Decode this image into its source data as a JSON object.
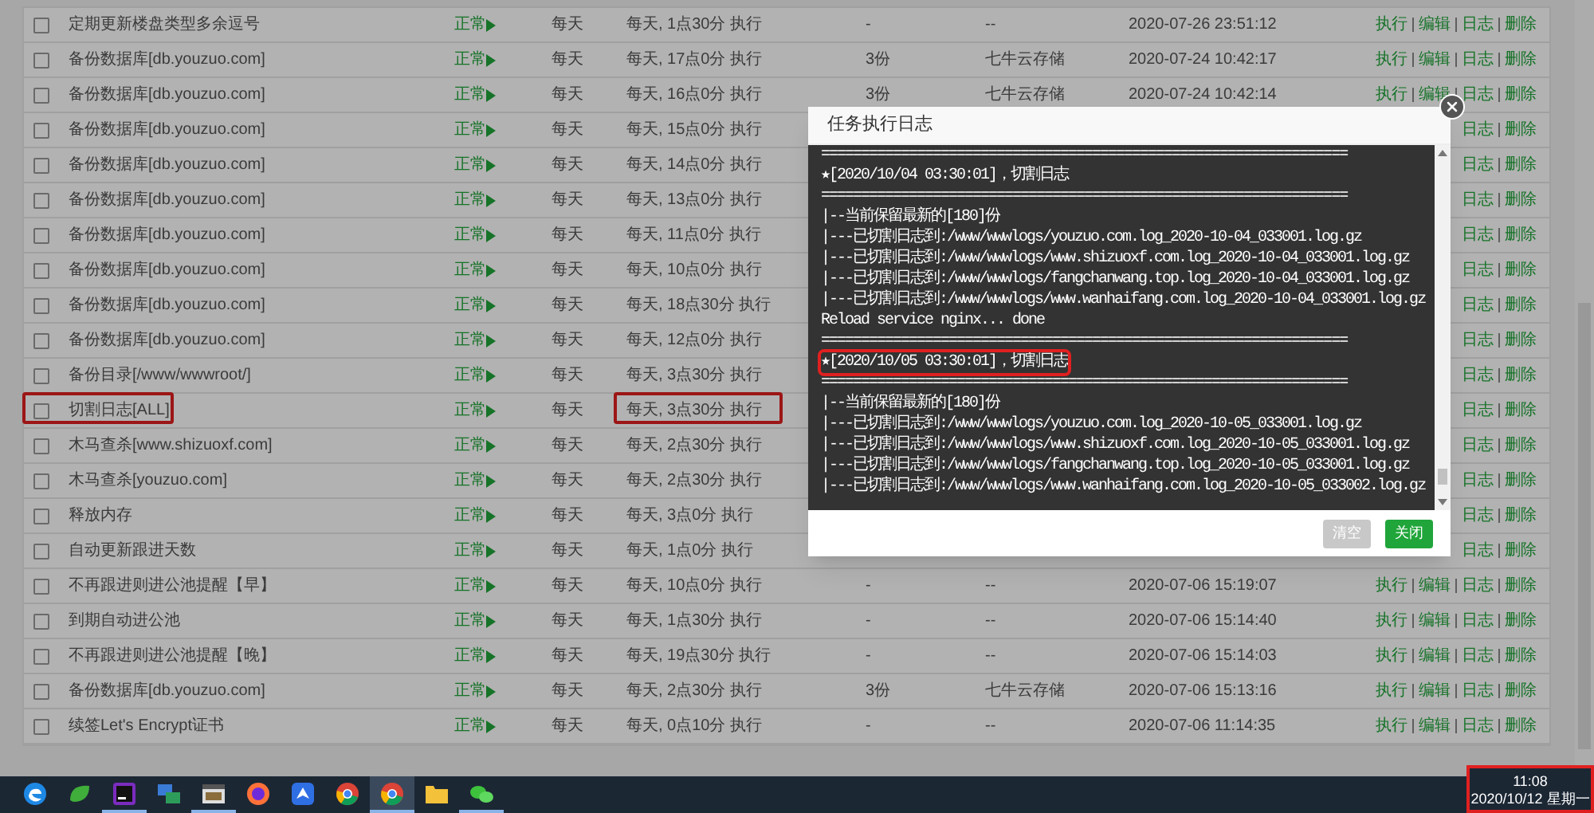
{
  "table": {
    "rows": [
      {
        "checked": false,
        "name": "定期更新楼盘类型多余逗号",
        "status": "正常",
        "frequency": "每天",
        "schedule": "每天, 1点30分 执行",
        "count": "-",
        "storage": "--",
        "date": "2020-07-26 23:51:12",
        "actions": [
          "执行",
          "编辑",
          "日志",
          "删除"
        ]
      },
      {
        "checked": false,
        "name": "备份数据库[db.youzuo.com]",
        "status": "正常",
        "frequency": "每天",
        "schedule": "每天, 17点0分 执行",
        "count": "3份",
        "storage": "七牛云存储",
        "date": "2020-07-24 10:42:17",
        "actions": [
          "执行",
          "编辑",
          "日志",
          "删除"
        ]
      },
      {
        "checked": false,
        "name": "备份数据库[db.youzuo.com]",
        "status": "正常",
        "frequency": "每天",
        "schedule": "每天, 16点0分 执行",
        "count": "3份",
        "storage": "七牛云存储",
        "date": "2020-07-24 10:42:14",
        "actions": [
          "执行",
          "编辑",
          "日志",
          "删除"
        ]
      },
      {
        "checked": false,
        "name": "备份数据库[db.youzuo.com]",
        "status": "正常",
        "frequency": "每天",
        "schedule": "每天, 15点0分 执行",
        "actions": [
          "日志",
          "删除"
        ]
      },
      {
        "checked": false,
        "name": "备份数据库[db.youzuo.com]",
        "status": "正常",
        "frequency": "每天",
        "schedule": "每天, 14点0分 执行",
        "actions": [
          "日志",
          "删除"
        ]
      },
      {
        "checked": false,
        "name": "备份数据库[db.youzuo.com]",
        "status": "正常",
        "frequency": "每天",
        "schedule": "每天, 13点0分 执行",
        "actions": [
          "日志",
          "删除"
        ]
      },
      {
        "checked": false,
        "name": "备份数据库[db.youzuo.com]",
        "status": "正常",
        "frequency": "每天",
        "schedule": "每天, 11点0分 执行",
        "actions": [
          "日志",
          "删除"
        ]
      },
      {
        "checked": false,
        "name": "备份数据库[db.youzuo.com]",
        "status": "正常",
        "frequency": "每天",
        "schedule": "每天, 10点0分 执行",
        "actions": [
          "日志",
          "删除"
        ]
      },
      {
        "checked": false,
        "name": "备份数据库[db.youzuo.com]",
        "status": "正常",
        "frequency": "每天",
        "schedule": "每天, 18点30分 执行",
        "actions": [
          "日志",
          "删除"
        ]
      },
      {
        "checked": false,
        "name": "备份数据库[db.youzuo.com]",
        "status": "正常",
        "frequency": "每天",
        "schedule": "每天, 12点0分 执行",
        "actions": [
          "日志",
          "删除"
        ]
      },
      {
        "checked": false,
        "name": "备份目录[/www/wwwroot/]",
        "status": "正常",
        "frequency": "每天",
        "schedule": "每天, 3点30分 执行",
        "actions": [
          "日志",
          "删除"
        ]
      },
      {
        "checked": false,
        "name": "切割日志[ALL]",
        "status": "正常",
        "frequency": "每天",
        "schedule": "每天, 3点30分 执行",
        "actions": [
          "日志",
          "删除"
        ],
        "name_highlighted": true,
        "schedule_highlighted": true
      },
      {
        "checked": false,
        "name": "木马查杀[www.shizuoxf.com]",
        "status": "正常",
        "frequency": "每天",
        "schedule": "每天, 2点30分 执行",
        "actions": [
          "日志",
          "删除"
        ]
      },
      {
        "checked": false,
        "name": "木马查杀[youzuo.com]",
        "status": "正常",
        "frequency": "每天",
        "schedule": "每天, 2点30分 执行",
        "actions": [
          "日志",
          "删除"
        ]
      },
      {
        "checked": false,
        "name": "释放内存",
        "status": "正常",
        "frequency": "每天",
        "schedule": "每天, 3点0分 执行",
        "actions": [
          "日志",
          "删除"
        ]
      },
      {
        "checked": false,
        "name": "自动更新跟进天数",
        "status": "正常",
        "frequency": "每天",
        "schedule": "每天, 1点0分 执行",
        "actions": [
          "日志",
          "删除"
        ]
      },
      {
        "checked": false,
        "name": "不再跟进则进公池提醒【早】",
        "status": "正常",
        "frequency": "每天",
        "schedule": "每天, 10点0分 执行",
        "count": "-",
        "storage": "--",
        "date": "2020-07-06 15:19:07",
        "actions": [
          "执行",
          "编辑",
          "日志",
          "删除"
        ]
      },
      {
        "checked": false,
        "name": "到期自动进公池",
        "status": "正常",
        "frequency": "每天",
        "schedule": "每天, 1点30分 执行",
        "count": "-",
        "storage": "--",
        "date": "2020-07-06 15:14:40",
        "actions": [
          "执行",
          "编辑",
          "日志",
          "删除"
        ]
      },
      {
        "checked": false,
        "name": "不再跟进则进公池提醒【晚】",
        "status": "正常",
        "frequency": "每天",
        "schedule": "每天, 19点30分 执行",
        "count": "-",
        "storage": "--",
        "date": "2020-07-06 15:14:03",
        "actions": [
          "执行",
          "编辑",
          "日志",
          "删除"
        ]
      },
      {
        "checked": false,
        "name": "备份数据库[db.youzuo.com]",
        "status": "正常",
        "frequency": "每天",
        "schedule": "每天, 2点30分 执行",
        "count": "3份",
        "storage": "七牛云存储",
        "date": "2020-07-06 15:13:16",
        "actions": [
          "执行",
          "编辑",
          "日志",
          "删除"
        ]
      },
      {
        "checked": false,
        "name": "续签Let's Encrypt证书",
        "status": "正常",
        "frequency": "每天",
        "schedule": "每天, 0点10分 执行",
        "count": "-",
        "storage": "--",
        "date": "2020-07-06 11:14:35",
        "actions": [
          "执行",
          "编辑",
          "日志",
          "删除"
        ]
      }
    ]
  },
  "dialog": {
    "title": "任务执行日志",
    "log": [
      {
        "text": "==================================================================",
        "highlighted": false
      },
      {
        "text": "★[2020/10/04 03:30:01]，切割日志",
        "highlighted": false
      },
      {
        "text": "==================================================================",
        "highlighted": false
      },
      {
        "text": "|--当前保留最新的[180]份",
        "highlighted": false
      },
      {
        "text": "|---已切割日志到:/www/wwwlogs/youzuo.com.log_2020-10-04_033001.log.gz",
        "highlighted": false
      },
      {
        "text": "|---已切割日志到:/www/wwwlogs/www.shizuoxf.com.log_2020-10-04_033001.log.gz",
        "highlighted": false
      },
      {
        "text": "|---已切割日志到:/www/wwwlogs/fangchanwang.top.log_2020-10-04_033001.log.gz",
        "highlighted": false
      },
      {
        "text": "|---已切割日志到:/www/wwwlogs/www.wanhaifang.com.log_2020-10-04_033001.log.gz",
        "highlighted": false
      },
      {
        "text": "Reload service nginx...  done",
        "highlighted": false
      },
      {
        "text": "==================================================================",
        "highlighted": false
      },
      {
        "text": "★[2020/10/05 03:30:01]，切割日志",
        "highlighted": true
      },
      {
        "text": "==================================================================",
        "highlighted": false
      },
      {
        "text": "|--当前保留最新的[180]份",
        "highlighted": false
      },
      {
        "text": "|---已切割日志到:/www/wwwlogs/youzuo.com.log_2020-10-05_033001.log.gz",
        "highlighted": false
      },
      {
        "text": "|---已切割日志到:/www/wwwlogs/www.shizuoxf.com.log_2020-10-05_033001.log.gz",
        "highlighted": false
      },
      {
        "text": "|---已切割日志到:/www/wwwlogs/fangchanwang.top.log_2020-10-05_033001.log.gz",
        "highlighted": false
      },
      {
        "text": "|---已切割日志到:/www/wwwlogs/www.wanhaifang.com.log_2020-10-05_033002.log.gz",
        "highlighted": false
      }
    ],
    "buttons": [
      {
        "label": "清空",
        "disabled": true
      },
      {
        "label": "关闭",
        "disabled": false
      }
    ]
  },
  "taskbar": {
    "apps": [
      {
        "kind": "edge",
        "running": false,
        "selected": false
      },
      {
        "kind": "leaf",
        "running": false,
        "selected": false
      },
      {
        "kind": "editor",
        "running": true,
        "selected": false
      },
      {
        "kind": "computer",
        "running": false,
        "selected": false
      },
      {
        "kind": "window",
        "running": true,
        "selected": false
      },
      {
        "kind": "firefox",
        "running": false,
        "selected": false
      },
      {
        "kind": "bird",
        "running": false,
        "selected": false
      },
      {
        "kind": "chrome",
        "running": false,
        "selected": false
      },
      {
        "kind": "chrome",
        "running": true,
        "selected": true
      },
      {
        "kind": "folder",
        "running": false,
        "selected": false
      },
      {
        "kind": "chat",
        "running": true,
        "selected": false
      }
    ],
    "clock": {
      "time": "11:08",
      "date": "2020/10/12 星期一",
      "highlighted": true
    }
  }
}
